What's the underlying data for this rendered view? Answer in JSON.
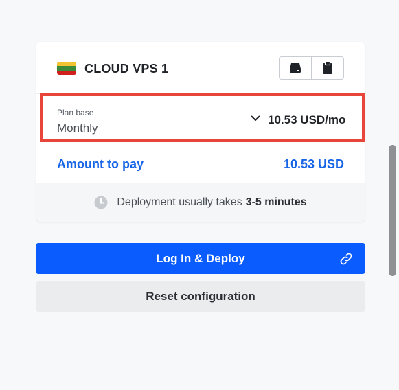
{
  "card": {
    "title": "CLOUD VPS 1",
    "flag": {
      "icon": "lithuania-flag-icon",
      "colors": [
        "#f1c232",
        "#3a8a3a",
        "#d0201e"
      ]
    },
    "actions": [
      {
        "icon": "server-icon"
      },
      {
        "icon": "clipboard-icon"
      }
    ]
  },
  "plan": {
    "label": "Plan base",
    "value": "Monthly",
    "price": "10.53 USD/mo",
    "highlight_color": "#e8463a"
  },
  "amount": {
    "label": "Amount to pay",
    "value": "10.53 USD",
    "color": "#1765e6"
  },
  "deployment_note": {
    "text": "Deployment usually takes",
    "duration": "3-5 minutes"
  },
  "buttons": {
    "deploy": "Log In & Deploy",
    "reset": "Reset configuration"
  },
  "colors": {
    "primary": "#0a5cff",
    "secondary_button": "#ebecee",
    "page_background": "#f7f8fa"
  }
}
